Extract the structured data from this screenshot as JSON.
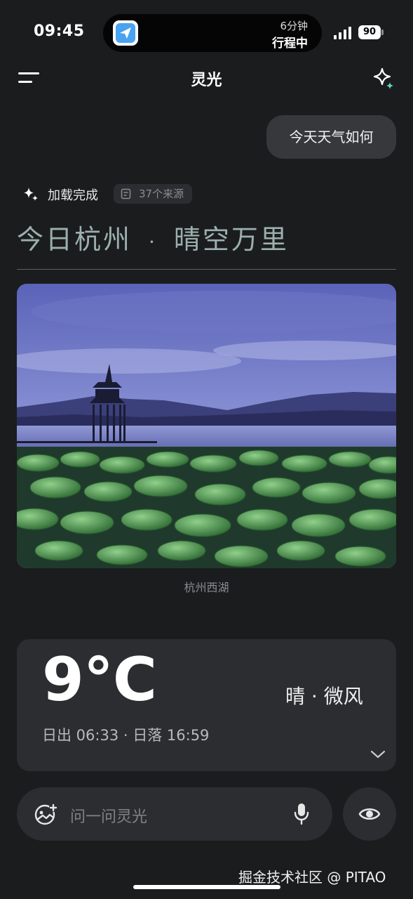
{
  "status_bar": {
    "time": "09:45",
    "trip_minutes": "6分钟",
    "trip_status": "行程中",
    "battery": "90"
  },
  "nav": {
    "title": "灵光",
    "menu_icon": "menu-icon",
    "action_icon": "sparkle-icon"
  },
  "chat": {
    "user_message": "今天天气如何"
  },
  "result": {
    "status": "加载完成",
    "sources": "37个来源",
    "headline_city": "今日杭州",
    "headline_separator": "·",
    "headline_summary": "晴空万里",
    "photo_caption": "杭州西湖"
  },
  "weather": {
    "temperature": "9°C",
    "condition": "晴 · 微风",
    "sun_times": "日出 06:33 · 日落 16:59"
  },
  "input": {
    "placeholder": "问一问灵光"
  },
  "footer": {
    "watermark": "掘金技术社区 @ PITAO"
  },
  "colors": {
    "background": "#1b1c1e",
    "card": "#2b2d30",
    "headline": "#9bb0ac"
  }
}
